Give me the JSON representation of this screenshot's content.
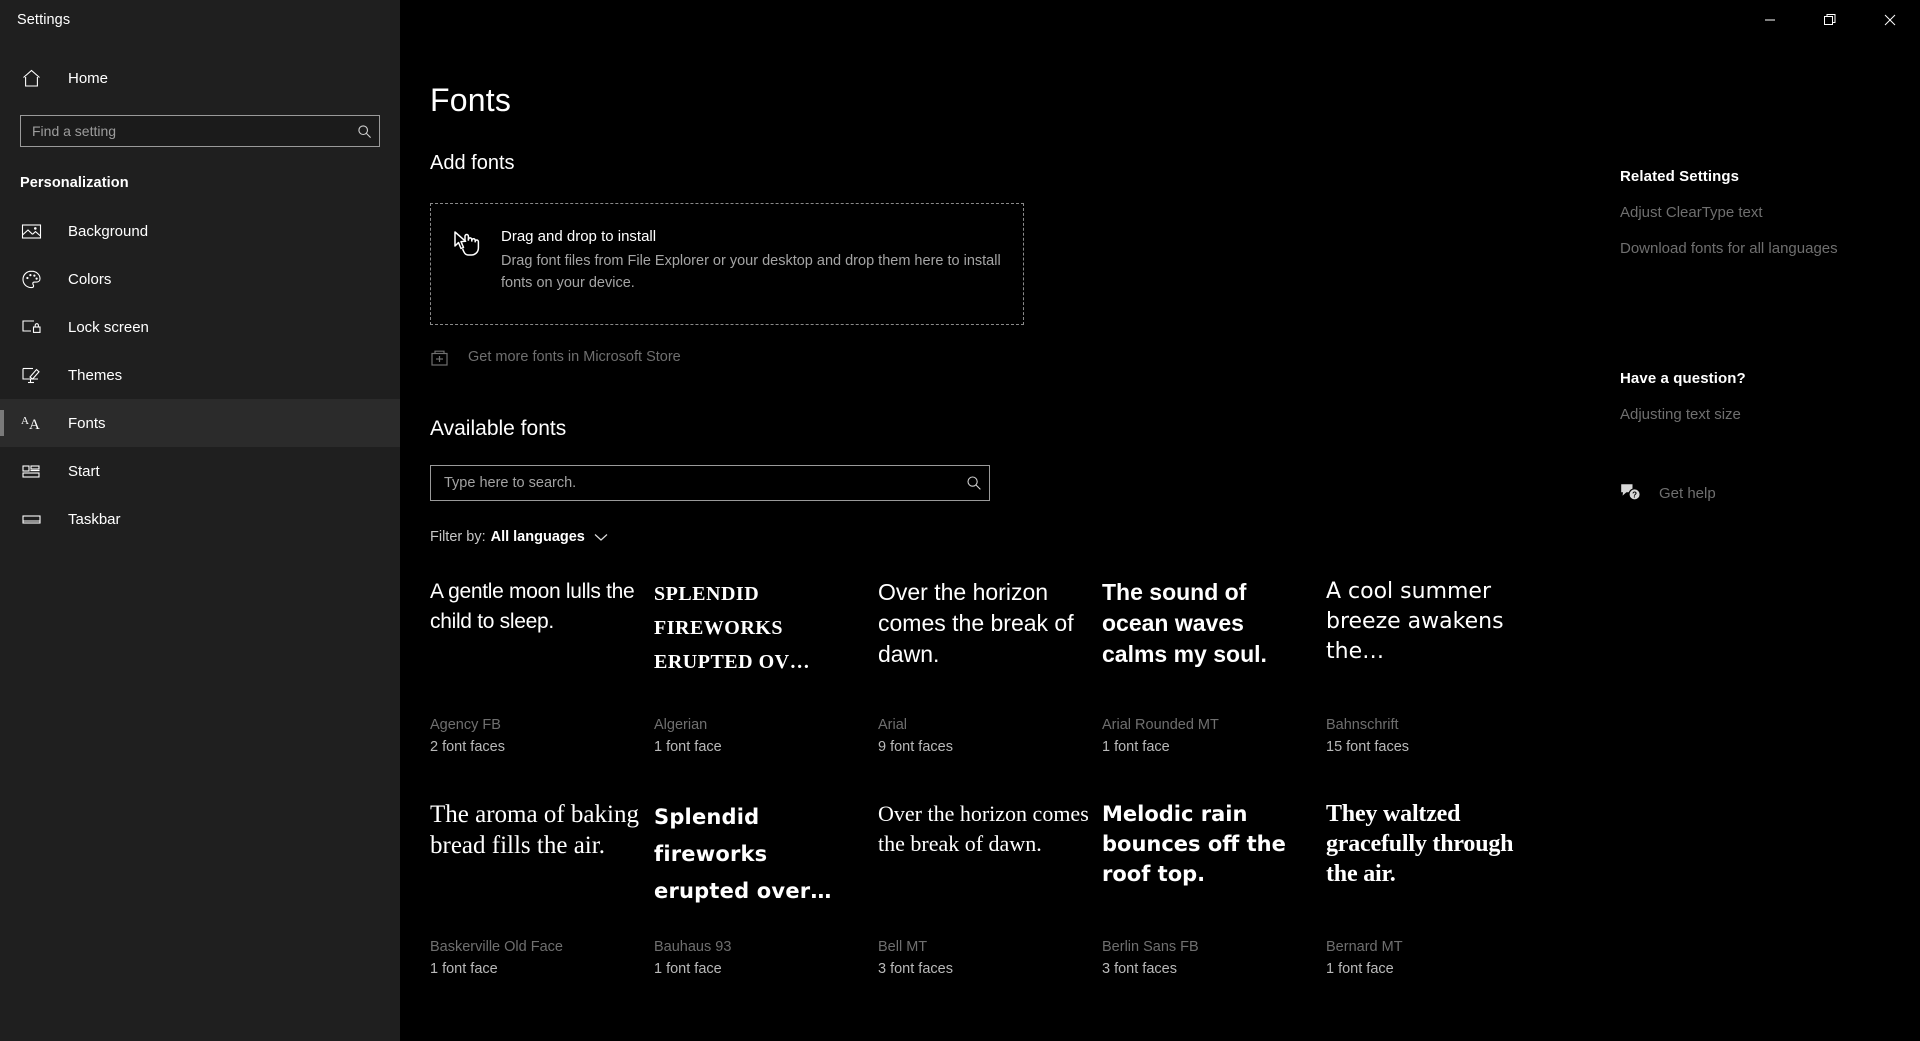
{
  "window": {
    "title": "Settings",
    "controls": {
      "minimize": "Minimize",
      "restore": "Restore",
      "close": "Close"
    }
  },
  "sidebar": {
    "home": {
      "label": "Home",
      "icon": "home-icon"
    },
    "search": {
      "placeholder": "Find a setting",
      "value": "",
      "icon": "search-icon"
    },
    "section_title": "Personalization",
    "items": [
      {
        "label": "Background",
        "icon": "image-icon",
        "selected": false
      },
      {
        "label": "Colors",
        "icon": "palette-icon",
        "selected": false
      },
      {
        "label": "Lock screen",
        "icon": "lock-screen-icon",
        "selected": false
      },
      {
        "label": "Themes",
        "icon": "themes-brush-icon",
        "selected": false
      },
      {
        "label": "Fonts",
        "icon": "font-aa-icon",
        "selected": true
      },
      {
        "label": "Start",
        "icon": "start-tiles-icon",
        "selected": false
      },
      {
        "label": "Taskbar",
        "icon": "taskbar-icon",
        "selected": false
      }
    ]
  },
  "main": {
    "page_title": "Fonts",
    "add_fonts": {
      "heading": "Add fonts",
      "dropzone": {
        "icon": "drag-drop-cursor-icon",
        "title": "Drag and drop to install",
        "description": "Drag font files from File Explorer or your desktop and drop them here to install fonts on your device."
      },
      "store_link": {
        "label": "Get more fonts in Microsoft Store",
        "icon": "microsoft-store-icon"
      }
    },
    "available_fonts": {
      "heading": "Available fonts",
      "search": {
        "placeholder": "Type here to search.",
        "value": "",
        "icon": "search-icon"
      },
      "filter": {
        "label": "Filter by:",
        "value": "All languages",
        "icon": "chevron-down-icon"
      },
      "cards": [
        {
          "sample": "A gentle moon lulls the child to sleep.",
          "name": "Agency FB",
          "faces": "2 font faces",
          "style": "s-agency"
        },
        {
          "sample": "SPLENDID FIREWORKS ERUPTED OV…",
          "name": "Algerian",
          "faces": "1 font face",
          "style": "s-algerian"
        },
        {
          "sample": "Over the horizon comes the break of dawn.",
          "name": "Arial",
          "faces": "9 font faces",
          "style": "s-arial"
        },
        {
          "sample": "The sound of ocean waves calms my soul.",
          "name": "Arial Rounded MT",
          "faces": "1 font face",
          "style": "s-arialrnd"
        },
        {
          "sample": "A cool summer breeze awakens the…",
          "name": "Bahnschrift",
          "faces": "15 font faces",
          "style": "s-bahn"
        },
        {
          "sample": "The aroma of baking bread fills the air.",
          "name": "Baskerville Old Face",
          "faces": "1 font face",
          "style": "s-baskerv"
        },
        {
          "sample": "Splendid fireworks erupted over…",
          "name": "Bauhaus 93",
          "faces": "1 font face",
          "style": "s-bauhaus"
        },
        {
          "sample": "Over the horizon comes the break of dawn.",
          "name": "Bell MT",
          "faces": "3 font faces",
          "style": "s-bell"
        },
        {
          "sample": "Melodic rain bounces off the roof top.",
          "name": "Berlin Sans FB",
          "faces": "3 font faces",
          "style": "s-berlin"
        },
        {
          "sample": "They waltzed gracefully through the air.",
          "name": "Bernard MT",
          "faces": "1 font face",
          "style": "s-bernard"
        }
      ]
    }
  },
  "rail": {
    "related_heading": "Related Settings",
    "related_links": [
      "Adjust ClearType text",
      "Download fonts for all languages"
    ],
    "question_heading": "Have a question?",
    "question_links": [
      "Adjusting text size"
    ],
    "help": {
      "label": "Get help",
      "icon": "help-chat-icon"
    }
  },
  "colors": {
    "window_bg": "#000000",
    "sidebar_bg": "#1f1f1f",
    "text_primary": "#ffffff",
    "text_secondary": "#b9b9b9",
    "text_muted": "#6f6f6f",
    "selection_bar": "#7a7a7a",
    "border": "#9a9a9a"
  }
}
